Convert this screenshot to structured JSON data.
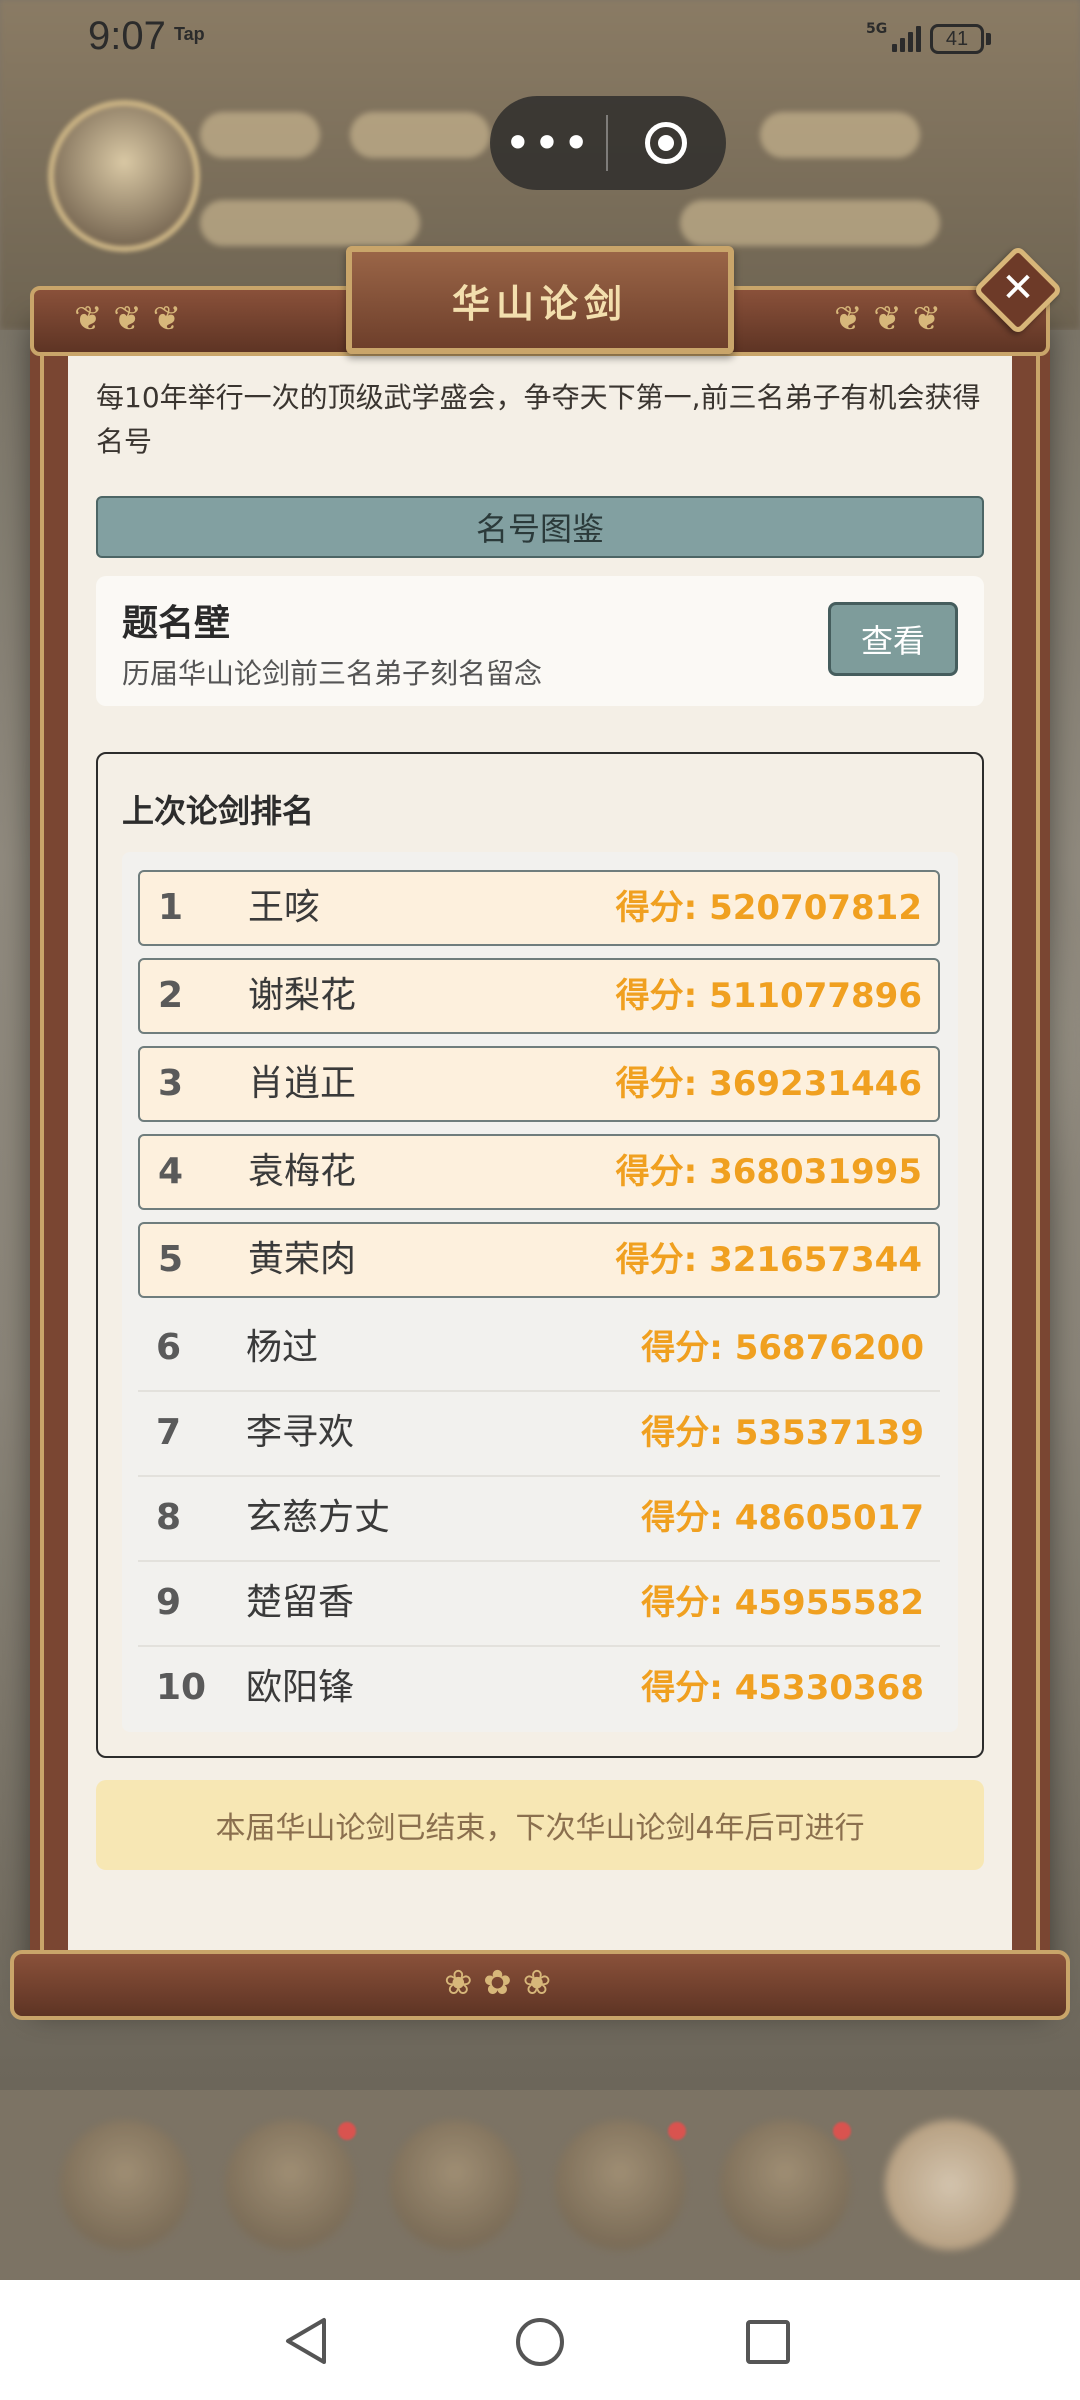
{
  "status_bar": {
    "time": "9:07",
    "tap_label": "Tap",
    "network": "5G",
    "battery": "41"
  },
  "dialog": {
    "title": "华山论剑",
    "description": "每10年举行一次的顶级武学盛会，争夺天下第一,前三名弟子有机会获得名号",
    "section_title": "名号图鉴",
    "wall": {
      "title": "题名壁",
      "subtitle": "历届华山论剑前三名弟子刻名留念",
      "button": "查看"
    },
    "ranking": {
      "title": "上次论剑排名",
      "rows": [
        {
          "rank": "1",
          "name": "王咳",
          "score": "得分: 520707812"
        },
        {
          "rank": "2",
          "name": "谢梨花",
          "score": "得分: 511077896"
        },
        {
          "rank": "3",
          "name": "肖逍正",
          "score": "得分: 369231446"
        },
        {
          "rank": "4",
          "name": "袁梅花",
          "score": "得分: 368031995"
        },
        {
          "rank": "5",
          "name": "黄荣肉",
          "score": "得分: 321657344"
        },
        {
          "rank": "6",
          "name": "杨过",
          "score": "得分: 56876200"
        },
        {
          "rank": "7",
          "name": "李寻欢",
          "score": "得分: 53537139"
        },
        {
          "rank": "8",
          "name": "玄慈方丈",
          "score": "得分: 48605017"
        },
        {
          "rank": "9",
          "name": "楚留香",
          "score": "得分: 45955582"
        },
        {
          "rank": "10",
          "name": "欧阳锋",
          "score": "得分: 45330368"
        }
      ]
    },
    "notice": "本届华山论剑已结束，下次华山论剑4年后可进行"
  },
  "colors": {
    "score": "#f0a020",
    "frame": "#7a4632",
    "frame_trim": "#c9a56a",
    "section_bar": "#82a0a1",
    "top_row_bg": "#fdf0dd",
    "notice_bg": "#f7e7b4"
  },
  "icons": {
    "close": "close-icon",
    "capsule_more": "more-dots-icon",
    "capsule_exit": "target-circle-icon",
    "nav_back": "back-triangle-icon",
    "nav_home": "home-circle-icon",
    "nav_recent": "recent-square-icon"
  }
}
